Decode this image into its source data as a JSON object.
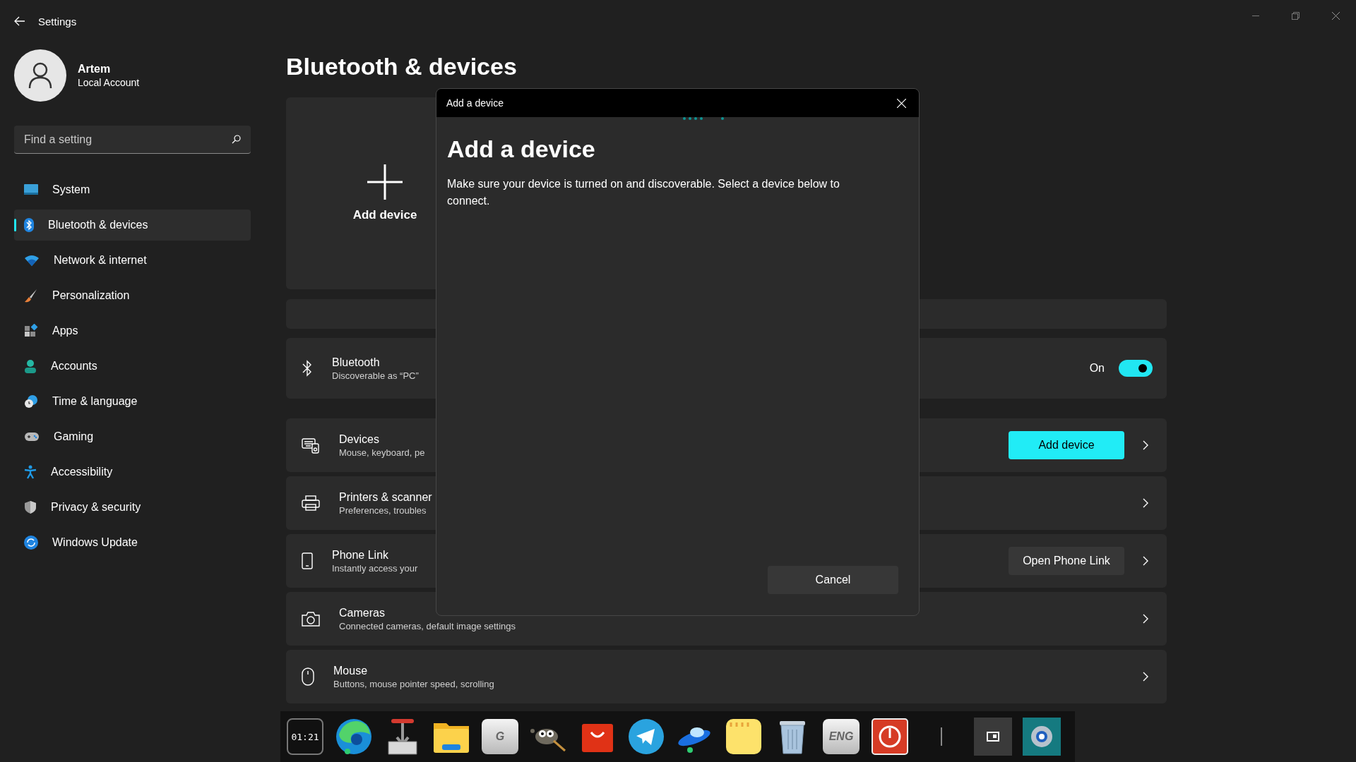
{
  "window": {
    "title": "Settings"
  },
  "account": {
    "name": "Artem",
    "type": "Local Account"
  },
  "search": {
    "placeholder": "Find a setting"
  },
  "nav": [
    {
      "label": "System",
      "selected": false
    },
    {
      "label": "Bluetooth & devices",
      "selected": true
    },
    {
      "label": "Network & internet",
      "selected": false
    },
    {
      "label": "Personalization",
      "selected": false
    },
    {
      "label": "Apps",
      "selected": false
    },
    {
      "label": "Accounts",
      "selected": false
    },
    {
      "label": "Time & language",
      "selected": false
    },
    {
      "label": "Gaming",
      "selected": false
    },
    {
      "label": "Accessibility",
      "selected": false
    },
    {
      "label": "Privacy & security",
      "selected": false
    },
    {
      "label": "Windows Update",
      "selected": false
    }
  ],
  "page_title": "Bluetooth & devices",
  "add_tile": {
    "label": "Add device"
  },
  "bluetooth": {
    "title": "Bluetooth",
    "subtitle": "Discoverable as “PC”",
    "state_label": "On",
    "on": true
  },
  "rows": [
    {
      "kind": "devices",
      "title": "Devices",
      "subtitle": "Mouse, keyboard, pe",
      "button": {
        "label": "Add device",
        "primary": true
      }
    },
    {
      "kind": "printer",
      "title": "Printers & scanner",
      "subtitle": "Preferences, troubles"
    },
    {
      "kind": "phone",
      "title": "Phone Link",
      "subtitle": "Instantly access your",
      "button": {
        "label": "Open Phone Link",
        "primary": false
      }
    },
    {
      "kind": "camera",
      "title": "Cameras",
      "subtitle": "Connected cameras, default image settings"
    },
    {
      "kind": "mouse",
      "title": "Mouse",
      "subtitle": "Buttons, mouse pointer speed, scrolling"
    }
  ],
  "dialog": {
    "title": "Add a device",
    "heading": "Add a device",
    "message": "Make sure your device is turned on and discoverable. Select a device below to connect.",
    "cancel": "Cancel"
  },
  "dock": [
    {
      "kind": "clock",
      "label": "01:21"
    },
    {
      "kind": "browser"
    },
    {
      "kind": "installer"
    },
    {
      "kind": "folder"
    },
    {
      "kind": "key",
      "label": "G"
    },
    {
      "kind": "mascot"
    },
    {
      "kind": "shop"
    },
    {
      "kind": "telegram"
    },
    {
      "kind": "ufo"
    },
    {
      "kind": "notes"
    },
    {
      "kind": "recycle"
    },
    {
      "kind": "key",
      "label": "ENG"
    },
    {
      "kind": "power"
    },
    {
      "kind": "separator"
    },
    {
      "kind": "widget"
    },
    {
      "kind": "settings"
    }
  ]
}
